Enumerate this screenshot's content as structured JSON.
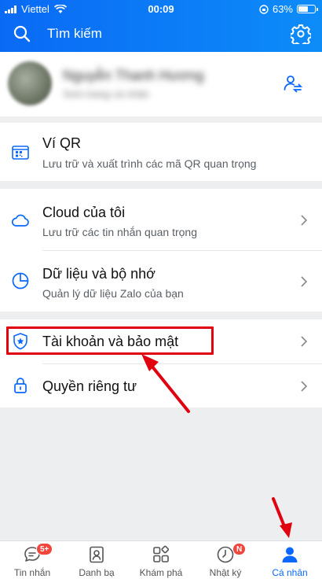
{
  "status_bar": {
    "carrier": "Viettel",
    "time": "00:09",
    "battery": "63%",
    "battery_level": 0.63
  },
  "header": {
    "search_placeholder": "Tìm kiếm"
  },
  "profile": {
    "name": "Nguyễn Thanh Hương",
    "subtitle": "Xem trang cá nhân"
  },
  "menu": {
    "qr": {
      "title": "Ví QR",
      "subtitle": "Lưu trữ và xuất trình các mã QR quan trọng"
    },
    "cloud": {
      "title": "Cloud của tôi",
      "subtitle": "Lưu trữ các tin nhắn quan trọng"
    },
    "storage": {
      "title": "Dữ liệu và bộ nhớ",
      "subtitle": "Quản lý dữ liệu Zalo của bạn"
    },
    "security": {
      "title": "Tài khoản và bảo mật"
    },
    "privacy": {
      "title": "Quyền riêng tư"
    }
  },
  "tabs": [
    {
      "label": "Tin nhắn",
      "badge": "5+"
    },
    {
      "label": "Danh bạ"
    },
    {
      "label": "Khám phá"
    },
    {
      "label": "Nhật ký",
      "badge": "N"
    },
    {
      "label": "Cá nhân",
      "active": true
    }
  ],
  "colors": {
    "accent": "#0a68ff",
    "annotation": "#e00010",
    "badge": "#f0463c"
  }
}
